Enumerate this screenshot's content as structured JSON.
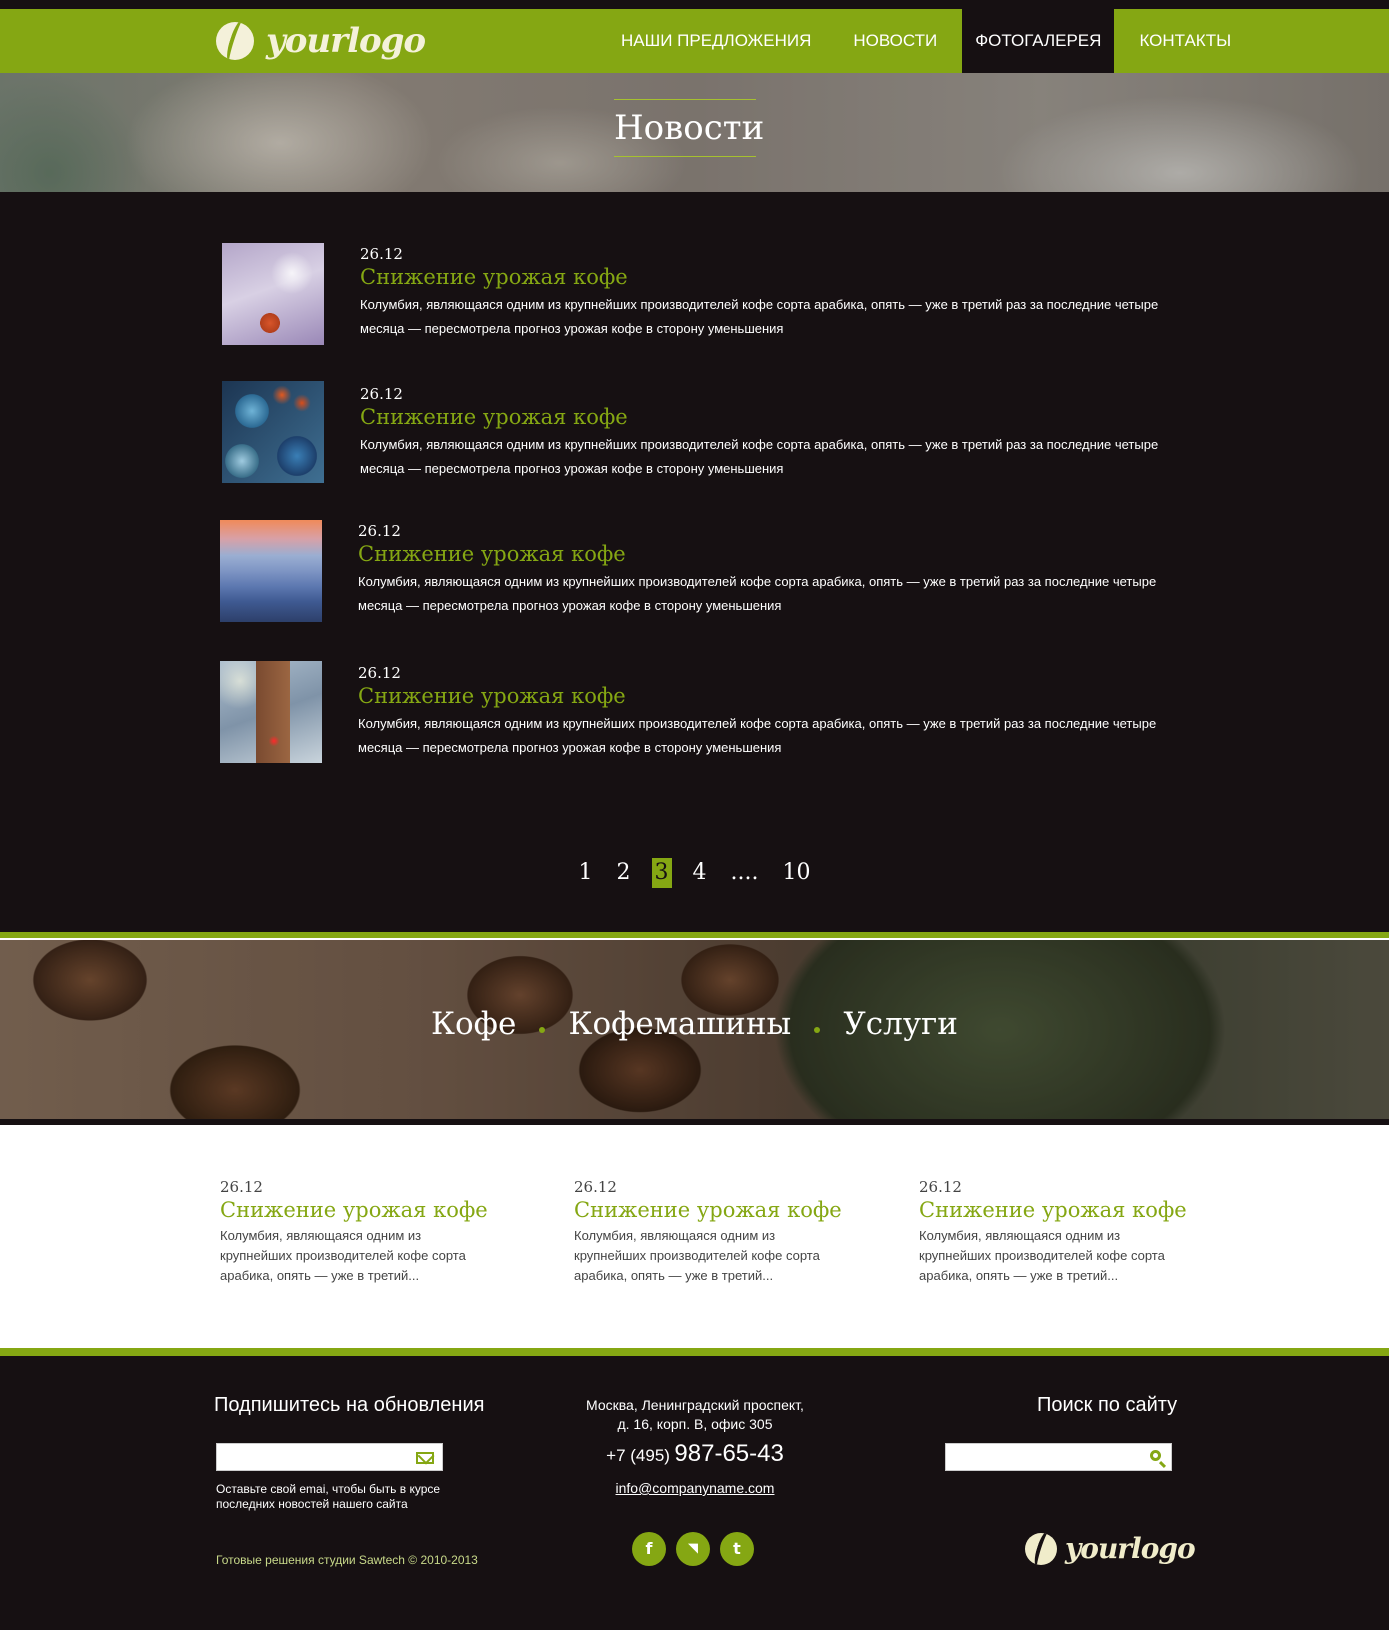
{
  "header": {
    "logo_text": "yourlogo",
    "nav": [
      "НАШИ ПРЕДЛОЖЕНИЯ",
      "НОВОСТИ",
      "ФОТОГАЛЕРЕЯ",
      "КОНТАКТЫ"
    ],
    "active_nav": "ФОТОГАЛЕРЕЯ"
  },
  "hero": {
    "title": "Новости"
  },
  "news": [
    {
      "date": "26.12",
      "title": "Снижение урожая кофе",
      "text": "Колумбия, являющаяся одним из крупнейших производителей кофе сорта арабика, опять — уже в третий раз за последние четыре месяца — пересмотрела  прогноз урожая  кофе в сторону уменьшения"
    },
    {
      "date": "26.12",
      "title": "Снижение урожая кофе",
      "text": "Колумбия, являющаяся одним из крупнейших производителей кофе сорта арабика, опять — уже в третий раз за последние четыре месяца — пересмотрела  прогноз урожая  кофе в сторону уменьшения"
    },
    {
      "date": "26.12",
      "title": "Снижение урожая кофе",
      "text": "Колумбия, являющаяся одним из крупнейших производителей кофе сорта арабика, опять — уже в третий раз за последние четыре месяца — пересмотрела  прогноз урожая  кофе в сторону уменьшения"
    },
    {
      "date": "26.12",
      "title": "Снижение урожая кофе",
      "text": "Колумбия, являющаяся одним из крупнейших производителей кофе сорта арабика, опять — уже в третий раз за последние четыре месяца — пересмотрела  прогноз урожая  кофе в сторону уменьшения"
    }
  ],
  "pagination": {
    "pages": [
      "1",
      "2",
      "3",
      "4",
      "....",
      "10"
    ],
    "current": "3"
  },
  "categories": [
    "Кофе",
    "Кофемашины",
    "Услуги"
  ],
  "columns": [
    {
      "date": "26.12",
      "title": "Снижение урожая кофе",
      "text": "Колумбия, являющаяся одним из крупнейших производителей кофе сорта арабика, опять — уже в третий..."
    },
    {
      "date": "26.12",
      "title": "Снижение урожая кофе",
      "text": "Колумбия, являющаяся одним из крупнейших производителей кофе сорта арабика, опять — уже в третий..."
    },
    {
      "date": "26.12",
      "title": "Снижение урожая кофе",
      "text": "Колумбия, являющаяся одним из крупнейших производителей кофе сорта арабика, опять — уже в третий..."
    }
  ],
  "footer": {
    "subscribe_heading": "Подпишитесь на обновления",
    "subscribe_placeholder": "",
    "subscribe_note_line1": "Оставьте свой emai, чтобы быть в курсе",
    "subscribe_note_line2": "последних новостей нашего сайта",
    "copyright": "Готовые решения студии Sawtech © 2010-2013",
    "address_line1": "Москва, Ленинградский проспект,",
    "address_line2": "д. 16, корп. В, офис 305",
    "phone_code": "+7 (495)",
    "phone_number": "987-65-43",
    "email": "info@companyname.com",
    "search_heading": "Поиск по сайту",
    "search_placeholder": "",
    "social": [
      {
        "name": "facebook-icon",
        "glyph": "f"
      },
      {
        "name": "rss-icon",
        "glyph": "◥"
      },
      {
        "name": "twitter-icon",
        "glyph": "t"
      }
    ],
    "logo_text": "yourlogo"
  },
  "colors": {
    "accent": "#85a713",
    "dark": "#161012",
    "light_text": "#ffffff"
  }
}
